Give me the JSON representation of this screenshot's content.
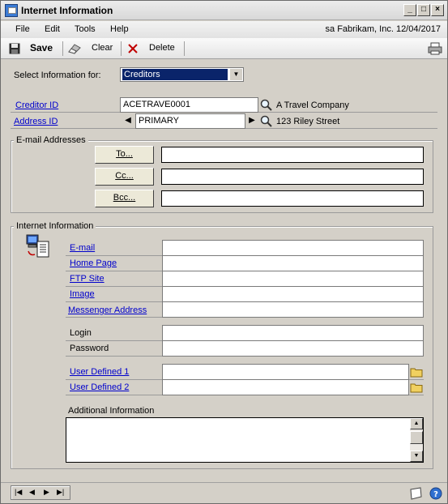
{
  "window": {
    "title": "Internet Information",
    "controls": {
      "minimize": "_",
      "maximize": "□",
      "close": "×"
    }
  },
  "menubar": {
    "items": [
      "File",
      "Edit",
      "Tools",
      "Help"
    ],
    "session": "sa  Fabrikam, Inc.  12/04/2017"
  },
  "toolbar": {
    "save_label": "Save",
    "clear_label": "Clear",
    "delete_label": "Delete"
  },
  "select_info": {
    "label": "Select Information for:",
    "value": "Creditors"
  },
  "creditor": {
    "id_label": "Creditor ID",
    "id_value": "ACETRAVE0001",
    "name": "A Travel Company",
    "address_label": "Address ID",
    "address_value": "PRIMARY",
    "address_desc": "123 Riley Street"
  },
  "email_group": {
    "title": "E-mail Addresses",
    "to_label": "To...",
    "cc_label": "Cc...",
    "bcc_label": "Bcc...",
    "to_value": "",
    "cc_value": "",
    "bcc_value": ""
  },
  "internet_group": {
    "title": "Internet Information",
    "email_label": "E-mail",
    "homepage_label": "Home Page",
    "ftp_label": "FTP Site",
    "image_label": "Image",
    "messenger_label": "Messenger Address",
    "login_label": "Login",
    "password_label": "Password",
    "user1_label": "User Defined 1",
    "user2_label": "User Defined 2",
    "additional_label": "Additional Information"
  },
  "colors": {
    "link": "#0000cc",
    "face": "#d4d0c8"
  }
}
